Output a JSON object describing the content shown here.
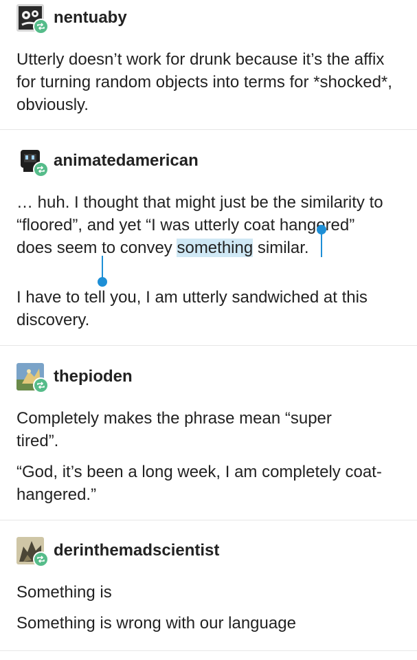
{
  "posts": [
    {
      "username": "nentuaby",
      "paragraphs": [
        "Utterly doesn’t work for drunk because it’s the affix for turning random objects into terms for *shocked*, obviously."
      ]
    },
    {
      "username": "animatedamerican",
      "paragraphs": [
        "I have to tell you, I am utterly sandwiched at this discovery."
      ],
      "selection": {
        "before": "… huh.  I thought that might just be the similarity to “floored”, and yet “I was utterly coat hangered” does seem to convey ",
        "selected": "something",
        "after": " similar."
      }
    },
    {
      "username": "thepioden",
      "paragraphs": [
        "Completely makes the phrase mean “super tired”.",
        "“God, it’s been a long week, I am completely coat-hangered.”"
      ]
    },
    {
      "username": "derinthemadscientist",
      "paragraphs": [
        "Something is",
        "Something is wrong with our language"
      ]
    }
  ],
  "colors": {
    "reblog_badge": "#56bc8a",
    "selection_highlight": "#cfe8f5",
    "selection_handle": "#1e8fd6",
    "divider": "#e6e6e6"
  },
  "icons": {
    "reblog": "reblog-icon"
  }
}
